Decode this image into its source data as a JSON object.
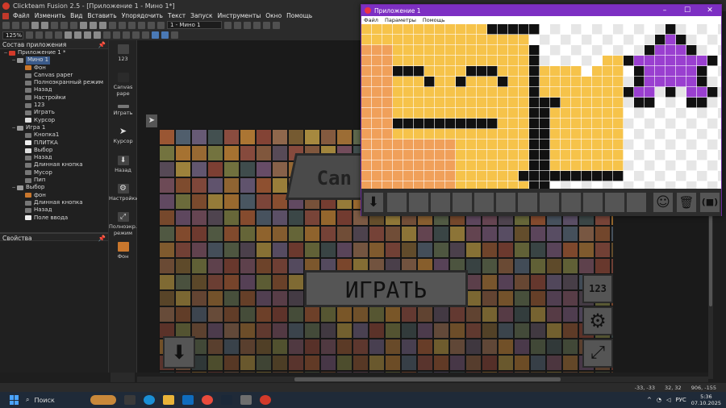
{
  "window": {
    "title": "Clickteam Fusion 2.5 - [Приложение 1 - Мино 1*]"
  },
  "menu": [
    "Файл",
    "Изменить",
    "Вид",
    "Вставить",
    "Упорядочить",
    "Текст",
    "Запуск",
    "Инструменты",
    "Окно",
    "Помощь"
  ],
  "toolbar": {
    "zoom": "125%",
    "frame_select": "1 - Мино 1"
  },
  "workspace": {
    "title": "Состав приложения",
    "items": [
      {
        "label": "Приложение 1 *",
        "level": 0,
        "exp": "−",
        "icon": "#d23a2a"
      },
      {
        "label": "Мино 1",
        "level": 1,
        "exp": "−",
        "icon": "#9a9a9a",
        "selected": true
      },
      {
        "label": "Фон",
        "level": 2,
        "icon": "#c9772d"
      },
      {
        "label": "Canvas paper",
        "level": 2,
        "icon": "#777"
      },
      {
        "label": "Полноэкранный режим",
        "level": 2,
        "icon": "#777"
      },
      {
        "label": "Назад",
        "level": 2,
        "icon": "#777"
      },
      {
        "label": "Настройки",
        "level": 2,
        "icon": "#777"
      },
      {
        "label": "123",
        "level": 2,
        "icon": "#777"
      },
      {
        "label": "Играть",
        "level": 2,
        "icon": "#777"
      },
      {
        "label": "Курсор",
        "level": 2,
        "icon": "#ddd"
      },
      {
        "label": "Игра 1",
        "level": 1,
        "exp": "−",
        "icon": "#9a9a9a"
      },
      {
        "label": "Кнопка1",
        "level": 2,
        "icon": "#777"
      },
      {
        "label": "ПЛИТКА",
        "level": 2,
        "icon": "#eee"
      },
      {
        "label": "Выбор",
        "level": 2,
        "icon": "#ddd"
      },
      {
        "label": "Назад",
        "level": 2,
        "icon": "#777"
      },
      {
        "label": "Длинная кнопка",
        "level": 2,
        "icon": "#777"
      },
      {
        "label": "Мусор",
        "level": 2,
        "icon": "#777"
      },
      {
        "label": "Пип",
        "level": 2,
        "icon": "#777"
      },
      {
        "label": "Выбор",
        "level": 1,
        "exp": "−",
        "icon": "#9a9a9a"
      },
      {
        "label": "фон",
        "level": 2,
        "icon": "#c9772d"
      },
      {
        "label": "Длинная кнопка",
        "level": 2,
        "icon": "#777"
      },
      {
        "label": "Назад",
        "level": 2,
        "icon": "#777"
      },
      {
        "label": "Поле ввода",
        "level": 2,
        "icon": "#eee"
      }
    ]
  },
  "properties": {
    "title": "Свойства"
  },
  "objects": [
    "123",
    "Canvas pape",
    "Играть",
    "Курсор",
    "Назад",
    "Настройки",
    "Полноэкр. режим",
    "Фон"
  ],
  "frame_buttons": {
    "play_label": "ИГРАТЬ",
    "score_label": "123",
    "canvas_label": "Can"
  },
  "preview": {
    "title": "Приложение 1",
    "menu": [
      "Файл",
      "Параметры",
      "Помощь"
    ]
  },
  "status": {
    "coords1": "-33, -33",
    "coords2": "32, 32",
    "coords3": "906, -155"
  },
  "taskbar": {
    "search": "Поиск",
    "lang": "РУС",
    "time": "5:36",
    "date": "07.10.2025"
  },
  "colors": {
    "accent": "#7d2fc3",
    "selection": "#3a5a8a",
    "taskbar": "#1f2a38"
  }
}
